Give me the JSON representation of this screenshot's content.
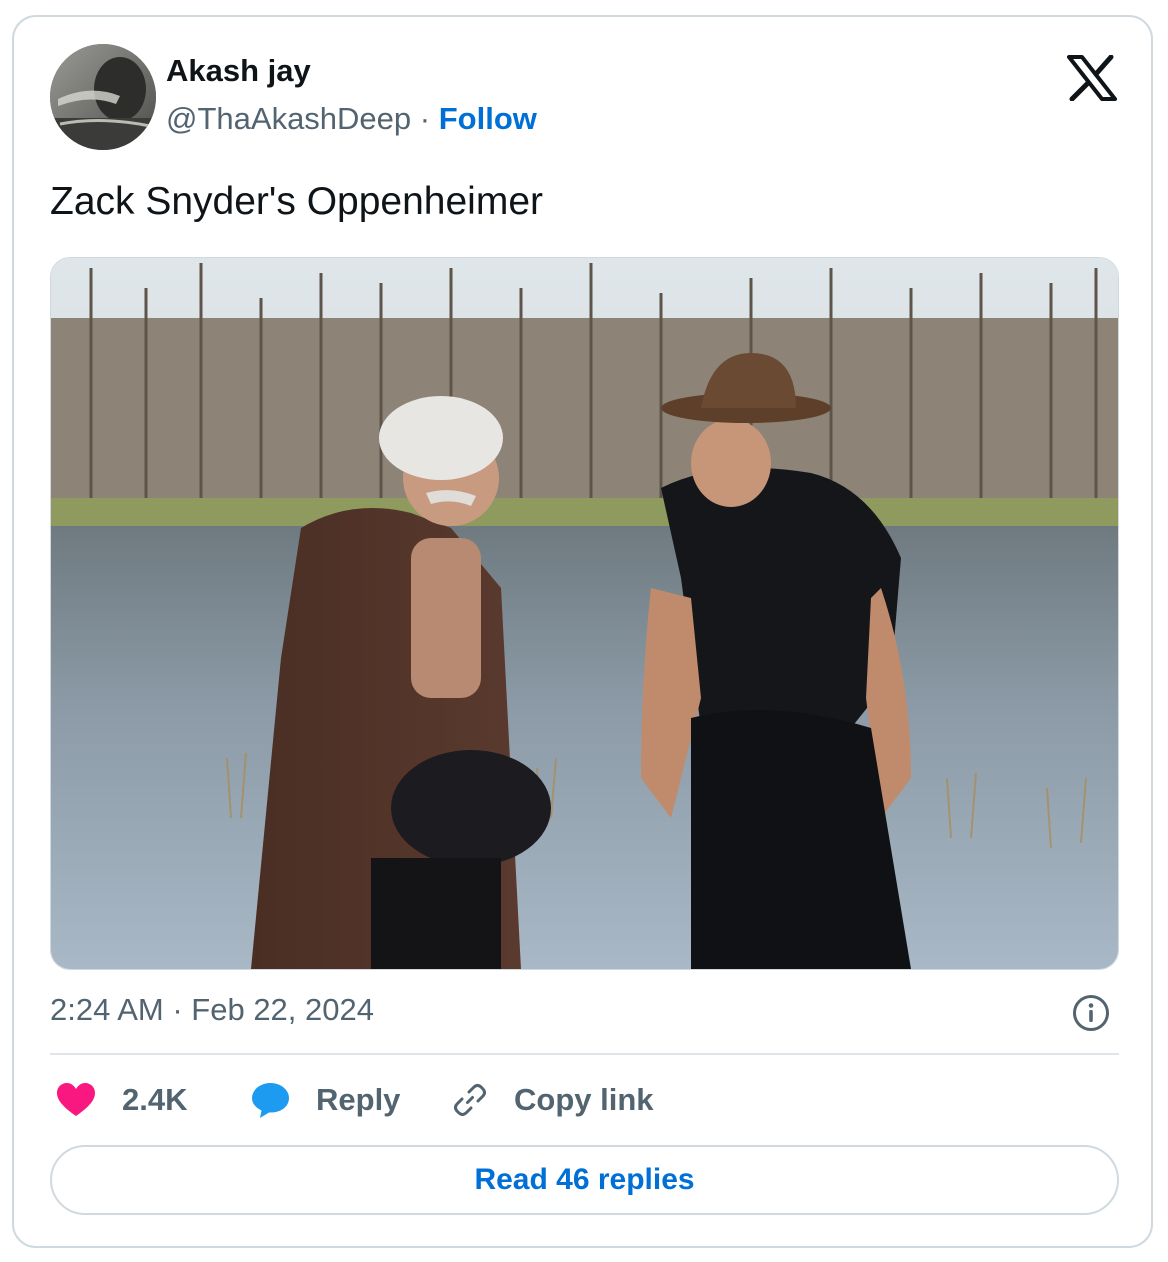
{
  "author": {
    "display_name": "Akash jay",
    "handle": "@ThaAkashDeep",
    "separator": "·",
    "follow_label": "Follow"
  },
  "brand": {
    "logo_icon": "x-logo-icon"
  },
  "tweet": {
    "text": "Zack Snyder's Oppenheimer",
    "media_icon": "photo",
    "timestamp": "2:24 AM · Feb 22, 2024"
  },
  "actions": {
    "like_count": "2.4K",
    "reply_label": "Reply",
    "copy_label": "Copy link"
  },
  "footer": {
    "read_replies_label": "Read 46 replies"
  },
  "colors": {
    "link_blue": "#006fd6",
    "like_pink": "#f91880",
    "reply_blue": "#1d9bf0",
    "muted_text": "#536471",
    "primary_text": "#0f1419",
    "border": "#cfd9de"
  }
}
